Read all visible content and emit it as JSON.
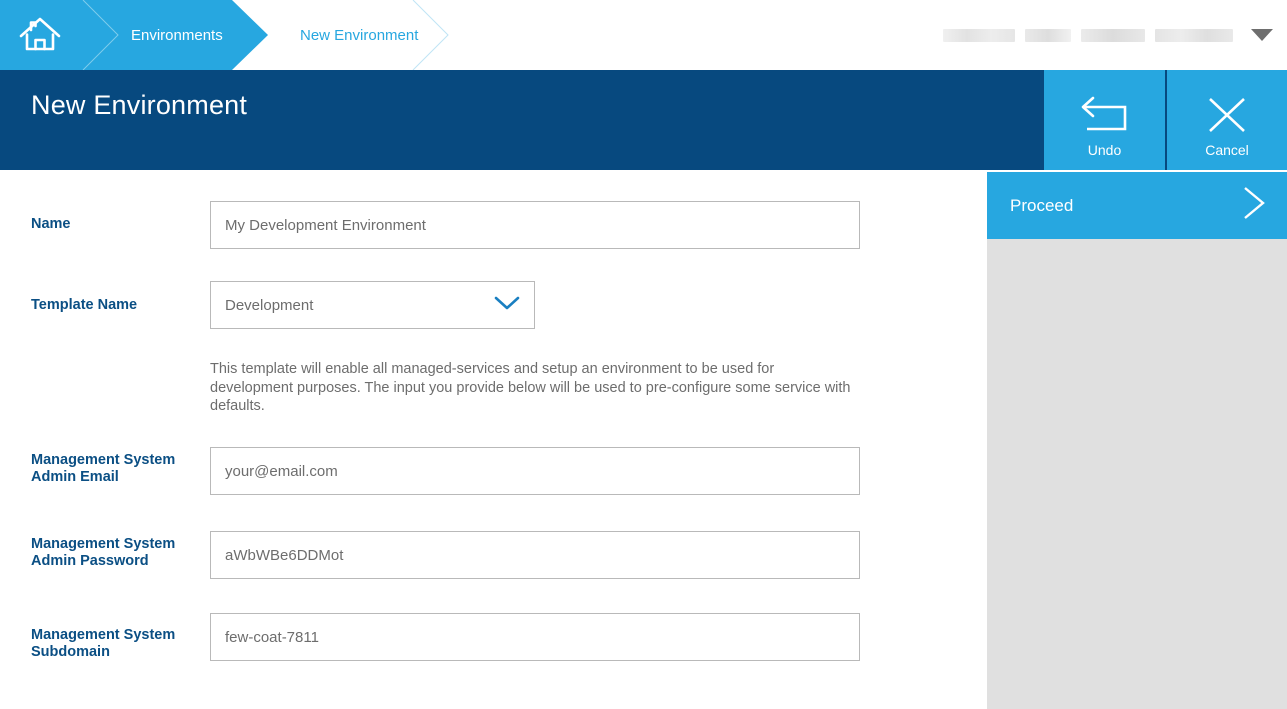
{
  "breadcrumb": {
    "home_icon": "home-icon",
    "items": [
      {
        "label": "Environments",
        "state": "active"
      },
      {
        "label": "New Environment",
        "state": "current"
      }
    ]
  },
  "user_menu": {
    "caret_icon": "chevron-down-icon",
    "name_redacted": true
  },
  "header": {
    "title": "New Environment",
    "actions": [
      {
        "label": "Undo",
        "icon": "undo-arrow-icon"
      },
      {
        "label": "Cancel",
        "icon": "close-x-icon"
      }
    ]
  },
  "proceed": {
    "label": "Proceed",
    "icon": "chevron-right-icon"
  },
  "form": {
    "fields": [
      {
        "label": "Name",
        "type": "text",
        "value": "My Development Environment"
      },
      {
        "label": "Template Name",
        "type": "select",
        "value": "Development",
        "icon": "chevron-down-icon"
      },
      {
        "label": "Management System Admin Email",
        "type": "text",
        "value": "your@email.com"
      },
      {
        "label": "Management System Admin Password",
        "type": "text",
        "value": "aWbWBe6DDMot"
      },
      {
        "label": "Management System Subdomain",
        "type": "text",
        "value": "few-coat-7811"
      }
    ],
    "template_description": "This template will enable all managed-services and setup an environment to be used for development purposes. The input you provide below will be used to pre-configure some service with defaults."
  },
  "colors": {
    "accent_light_blue": "#27a7e0",
    "header_dark_blue": "#07497f",
    "label_blue": "#0b4f84",
    "panel_gray": "#e0e0e0"
  }
}
